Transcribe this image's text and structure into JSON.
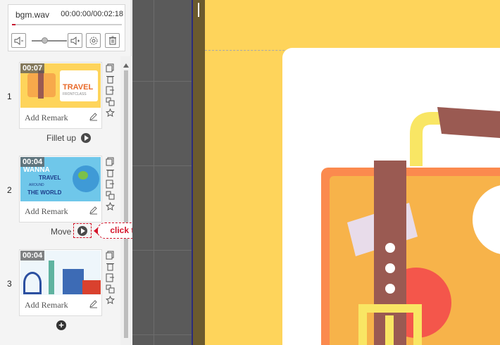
{
  "audio": {
    "filename": "bgm.wav",
    "time": "00:00:00/00:02:18",
    "progress": 0.03,
    "volume": 0.35
  },
  "slides": [
    {
      "number": "1",
      "duration": "00:07",
      "remark": "Add Remark",
      "transition": "Fillet up"
    },
    {
      "number": "2",
      "duration": "00:04",
      "remark": "Add Remark",
      "transition": "Move"
    },
    {
      "number": "3",
      "duration": "00:04",
      "remark": "Add Remark"
    }
  ],
  "thumbnails": {
    "slide1": {
      "title": "TRAVEL",
      "subtitle": "FRONTCLASS"
    },
    "slide2": {
      "line1": "WANNA",
      "line2": "TRAVEL",
      "line3": "AROUND",
      "line4": "THE WORLD"
    }
  },
  "callout": {
    "text": "click to preview"
  },
  "colors": {
    "accent_red": "#d4142a",
    "canvas_yellow": "#fed45b",
    "suitcase_orange": "#f7a94b",
    "strap_brown": "#9a5a52"
  },
  "icons": [
    "volume-down-icon",
    "volume-up-icon",
    "settings-icon",
    "trash-icon",
    "copy-icon",
    "delete-icon",
    "export-icon",
    "duplicate-icon",
    "star-icon",
    "edit-icon",
    "play-icon",
    "add-icon"
  ]
}
